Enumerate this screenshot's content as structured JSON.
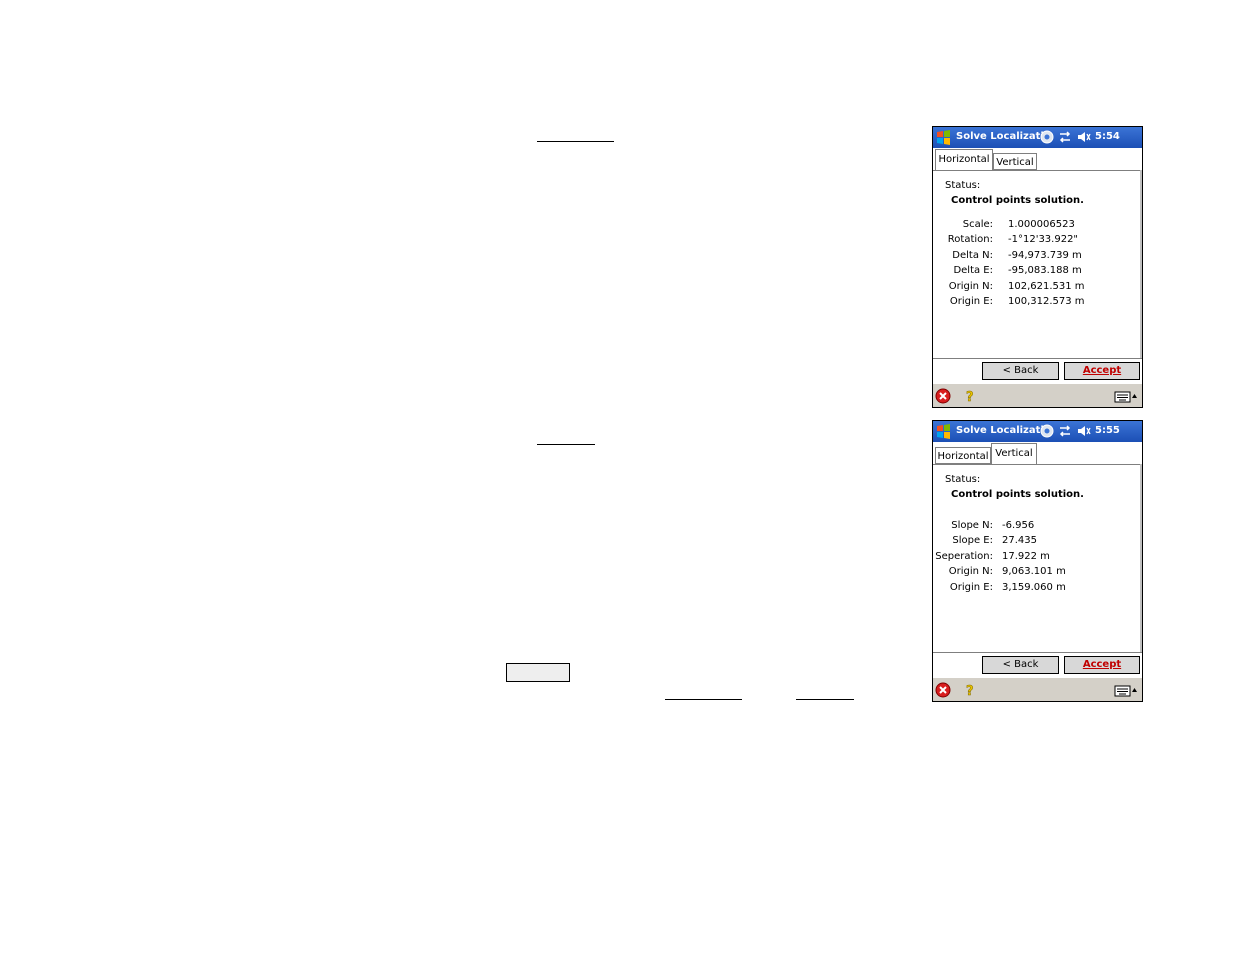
{
  "devices": [
    {
      "title": "Solve Localizati",
      "time": "5:54",
      "tabs": [
        {
          "label": "Horizontal",
          "active": true
        },
        {
          "label": "Vertical",
          "active": false
        }
      ],
      "status_label": "Status:",
      "status_value": "Control points solution.",
      "rows": [
        {
          "label": "Scale:",
          "value": "1.000006523"
        },
        {
          "label": "Rotation:",
          "value": "-1°12'33.922\""
        },
        {
          "label": "Delta N:",
          "value": "-94,973.739 m"
        },
        {
          "label": "Delta E:",
          "value": "-95,083.188 m"
        },
        {
          "label": "Origin N:",
          "value": "102,621.531 m"
        },
        {
          "label": "Origin E:",
          "value": "100,312.573 m"
        }
      ],
      "back_label": "< Back",
      "accept_label": "Accept"
    },
    {
      "title": "Solve Localizati",
      "time": "5:55",
      "tabs": [
        {
          "label": "Horizontal",
          "active": false
        },
        {
          "label": "Vertical",
          "active": true
        }
      ],
      "status_label": "Status:",
      "status_value": "Control points solution.",
      "rows": [
        {
          "label": "Slope N:",
          "value": "-6.956"
        },
        {
          "label": "Slope E:",
          "value": "27.435"
        },
        {
          "label": "Seperation:",
          "value": "17.922 m"
        },
        {
          "label": "Origin N:",
          "value": "9,063.101 m"
        },
        {
          "label": "Origin E:",
          "value": "3,159.060 m"
        }
      ],
      "back_label": "< Back",
      "accept_label": "Accept"
    }
  ],
  "icons": {
    "start": "windows-logo-icon",
    "gps": "satellite-icon",
    "sync": "connectivity-icon",
    "volume": "speaker-icon",
    "close": "close-icon",
    "help": "help-icon",
    "keyboard": "keyboard-icon"
  }
}
